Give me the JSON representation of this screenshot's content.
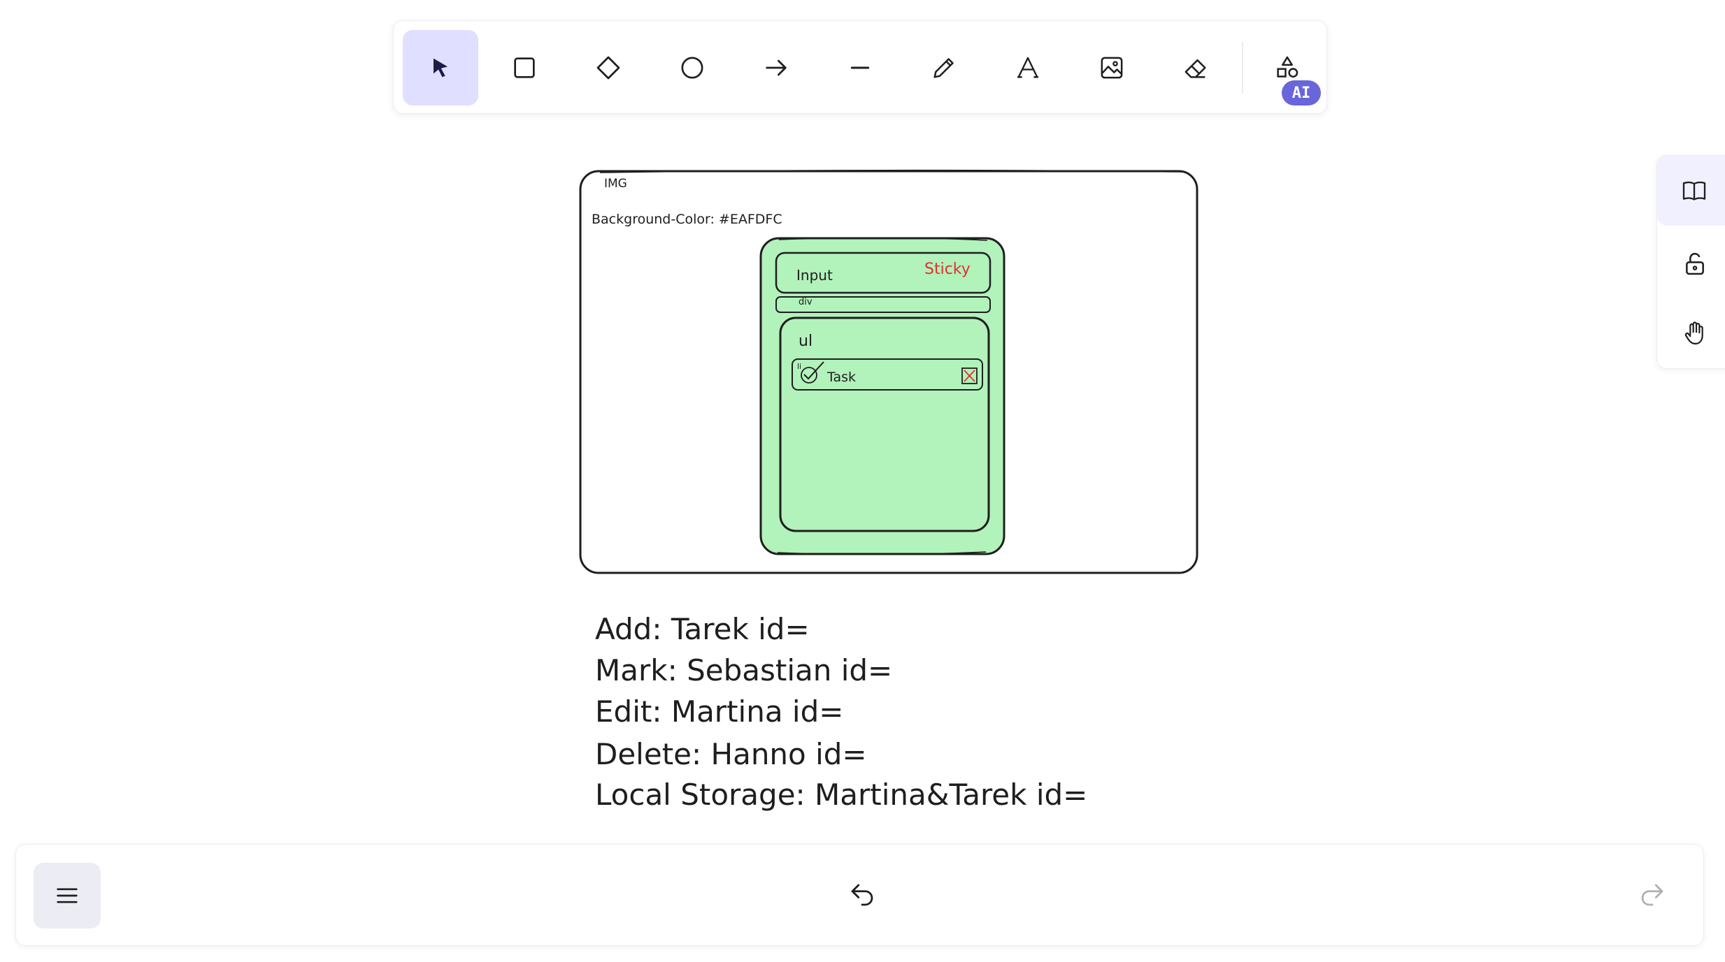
{
  "toolbar": {
    "tools": [
      {
        "name": "selection",
        "icon": "pointer-icon",
        "active": true
      },
      {
        "name": "rectangle",
        "icon": "rectangle-icon"
      },
      {
        "name": "diamond",
        "icon": "diamond-icon"
      },
      {
        "name": "ellipse",
        "icon": "circle-icon"
      },
      {
        "name": "arrow",
        "icon": "arrow-icon"
      },
      {
        "name": "line",
        "icon": "line-icon"
      },
      {
        "name": "draw",
        "icon": "pencil-icon"
      },
      {
        "name": "text",
        "icon": "text-icon"
      },
      {
        "name": "image",
        "icon": "image-icon"
      },
      {
        "name": "eraser",
        "icon": "eraser-icon"
      },
      {
        "name": "more-tools",
        "icon": "shapes-icon"
      }
    ],
    "ai_badge": "AI",
    "accent": "#6965db",
    "active_bg": "#e0dfff"
  },
  "side_panel": {
    "items": [
      "book-icon",
      "unlock-icon",
      "hand-icon"
    ]
  },
  "canvas": {
    "frame_label": "IMG",
    "bg_note": "Background-Color: #EAFDFC",
    "card_fill": "#b2f2bb",
    "input_label": "Input",
    "sticky_label": "Sticky",
    "sticky_color": "#e03131",
    "div_label": "div",
    "ul_label": "ul",
    "li_label": "li",
    "task_label": "Task",
    "notes": [
      "Add: Tarek id=",
      "Mark: Sebastian id=",
      "Edit: Martina id=",
      "Delete: Hanno id=",
      "Local Storage: Martina&Tarek id="
    ]
  },
  "footer": {
    "menu_icon": "hamburger-icon",
    "undo_icon": "undo-icon",
    "redo_icon": "redo-icon"
  }
}
